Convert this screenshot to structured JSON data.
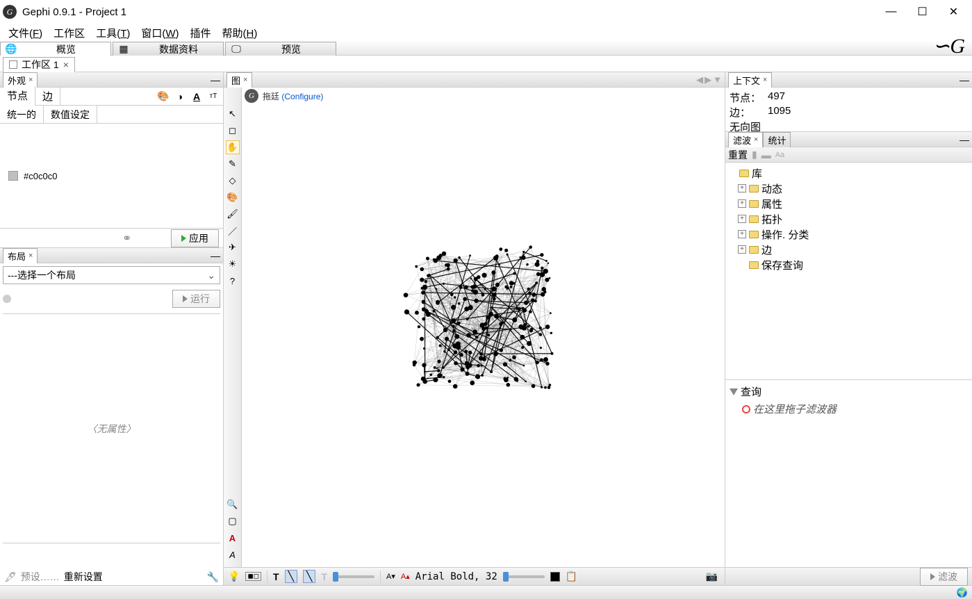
{
  "title": "Gephi 0.9.1 - Project 1",
  "menu": {
    "file": "文件(F)",
    "workspace_menu": "工作区",
    "tools": "工具(T)",
    "window": "窗口(W)",
    "plugins": "插件",
    "help": "帮助(H)"
  },
  "toolbar": {
    "overview": "概览",
    "datalab": "数据资料",
    "preview": "预览"
  },
  "workspace_tab": "工作区 1",
  "appearance": {
    "title": "外观",
    "node_tab": "节点",
    "edge_tab": "边",
    "uniform": "统一的",
    "numeric": "数值设定",
    "color_hex": "#c0c0c0",
    "apply": "应用"
  },
  "layout": {
    "title": "布局",
    "placeholder": "---选择一个布局",
    "run": "运行",
    "no_attr": "〈无属性〉",
    "preset": "预设……",
    "reset": "重新设置"
  },
  "graph": {
    "title": "图",
    "drag": "拖廷",
    "configure": "(Configure)",
    "font": "Arial Bold, 32"
  },
  "context": {
    "title": "上下文",
    "nodes_label": "节点：",
    "nodes_value": "497",
    "edges_label": "边：",
    "edges_value": "1095",
    "graph_type": "无向图"
  },
  "filter": {
    "tab_filter": "滤波",
    "tab_stats": "统计",
    "reset": "重置",
    "library": "库",
    "dynamic": "动态",
    "attribute": "属性",
    "topology": "拓扑",
    "operation": "操作. 分类",
    "edge": "边",
    "saved": "保存查询",
    "query": "查询",
    "drag_hint": "在这里拖子滤波器",
    "filter_btn": "滤波"
  }
}
